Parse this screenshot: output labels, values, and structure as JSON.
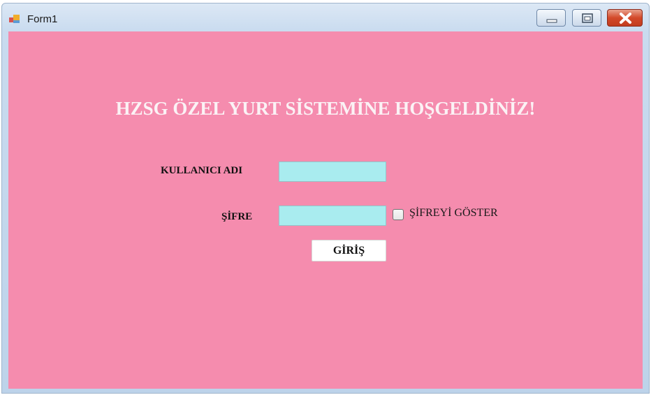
{
  "window": {
    "title": "Form1",
    "controls": {
      "minimize": "minimize-icon",
      "maximize": "maximize-icon",
      "close": "close-icon"
    }
  },
  "form": {
    "heading": "HZSG ÖZEL YURT SİSTEMİNE HOŞGELDİNİZ!",
    "username_label": "KULLANICI ADI",
    "username_value": "",
    "password_label": "ŞİFRE",
    "password_value": "",
    "show_password_label": "ŞİFREYİ GÖSTER",
    "show_password_checked": false,
    "login_button": "GİRİŞ"
  },
  "colors": {
    "form_background": "#f58cae",
    "input_background": "#a9ecef",
    "heading_text": "#fbf2f5",
    "close_button": "#d3492a"
  }
}
